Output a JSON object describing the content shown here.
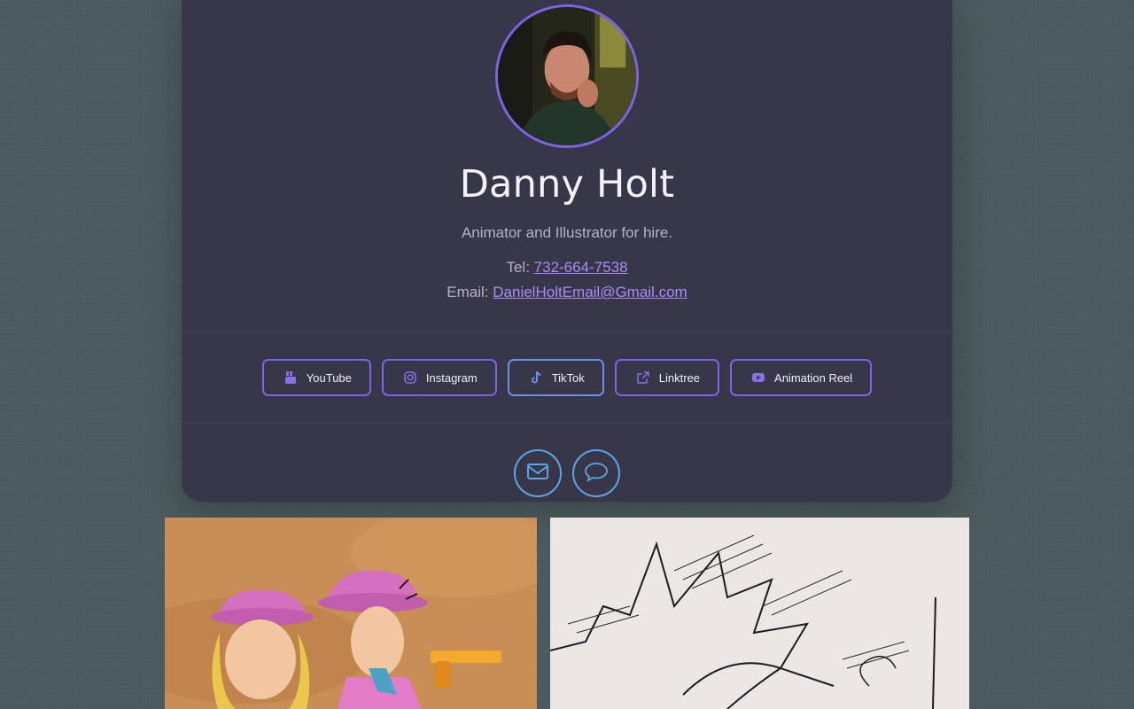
{
  "profile": {
    "name": "Danny Holt",
    "tagline": "Animator and Illustrator for hire.",
    "tel_label": "Tel: ",
    "tel_value": "732-664-7538",
    "email_label": "Email: ",
    "email_value": "DanielHoltEmail@Gmail.com"
  },
  "links": [
    {
      "label": "YouTube",
      "icon": "youtube-icon"
    },
    {
      "label": "Instagram",
      "icon": "instagram-icon"
    },
    {
      "label": "TikTok",
      "icon": "tiktok-icon"
    },
    {
      "label": "Linktree",
      "icon": "external-link-icon"
    },
    {
      "label": "Animation Reel",
      "icon": "youtube-play-icon"
    }
  ],
  "actions": [
    {
      "icon": "envelope-icon"
    },
    {
      "icon": "chat-bubble-icon"
    }
  ],
  "colors": {
    "background": "#4b5a5e",
    "card": "#383649",
    "accent": "#7f63e6",
    "link": "#a98cf5",
    "action_border": "#5aa6e8"
  }
}
